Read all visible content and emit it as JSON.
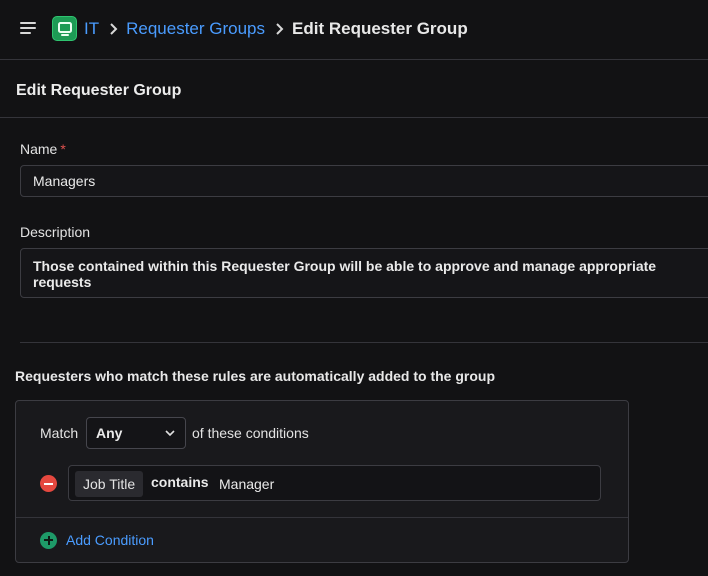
{
  "header": {
    "breadcrumbs": [
      "IT",
      "Requester Groups",
      "Edit Requester Group"
    ]
  },
  "section": {
    "title": "Edit Requester Group"
  },
  "form": {
    "name_label": "Name",
    "required_marker": "*",
    "name_value": "Managers",
    "description_label": "Description",
    "description_value": "Those contained within this Requester Group will be able to approve and manage appropriate requests"
  },
  "rules": {
    "title": "Requesters who match these rules are automatically added to the group",
    "match_label": "Match",
    "match_value": "Any",
    "match_suffix": "of these conditions",
    "conditions": [
      {
        "field": "Job Title",
        "operator": "contains",
        "value": "Manager"
      }
    ],
    "add_condition_label": "Add Condition"
  },
  "colors": {
    "accent_link": "#4a9cff",
    "app_icon": "#1d9b55",
    "remove": "#e5483f",
    "add": "#1e9a68",
    "required": "#e0524f"
  }
}
